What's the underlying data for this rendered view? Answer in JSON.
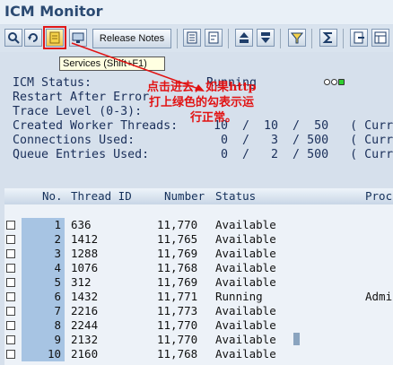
{
  "window": {
    "title": "ICM Monitor"
  },
  "toolbar": {
    "release_notes_label": "Release Notes",
    "buttons": [
      "refresh-icon",
      "reload-icon",
      "services-icon",
      "monitor-icon",
      "info-icon",
      "document-icon",
      "print-icon",
      "save-icon",
      "filter-icon",
      "sum-icon",
      "export-icon",
      "layout-icon"
    ]
  },
  "tooltip": {
    "text": "Services   (Shift+F1)"
  },
  "status": {
    "icm_status_label": "ICM Status:",
    "icm_status_value": "Running",
    "restart_label": "Restart After Error",
    "trace_level_label": "Trace Level (0-3):",
    "created_workers_label": "Created Worker Threads:",
    "created_workers_values": "10  /  10  /  50   ( Curr",
    "connections_label": "Connections Used:",
    "connections_values": "0  /   3  / 500   ( Curr",
    "queue_label": "Queue Entries Used:",
    "queue_values": "0  /   2  / 500   ( Curr"
  },
  "annotation": {
    "line1": "点击进去，如果http",
    "line2": "打上绿色的勾表示运",
    "line3": "行正常。",
    "color": "#e21212"
  },
  "table": {
    "headers": {
      "no": "No.",
      "thread_id": "Thread ID",
      "number": "Number",
      "status": "Status",
      "proc": "Proc"
    },
    "rows": [
      {
        "no": "1",
        "thread_id": "636",
        "number": "11,770",
        "status": "Available",
        "proc": ""
      },
      {
        "no": "2",
        "thread_id": "1412",
        "number": "11,765",
        "status": "Available",
        "proc": ""
      },
      {
        "no": "3",
        "thread_id": "1288",
        "number": "11,769",
        "status": "Available",
        "proc": ""
      },
      {
        "no": "4",
        "thread_id": "1076",
        "number": "11,768",
        "status": "Available",
        "proc": ""
      },
      {
        "no": "5",
        "thread_id": "312",
        "number": "11,769",
        "status": "Available",
        "proc": ""
      },
      {
        "no": "6",
        "thread_id": "1432",
        "number": "11,771",
        "status": "Running",
        "proc": "Admi"
      },
      {
        "no": "7",
        "thread_id": "2216",
        "number": "11,773",
        "status": "Available",
        "proc": ""
      },
      {
        "no": "8",
        "thread_id": "2244",
        "number": "11,770",
        "status": "Available",
        "proc": ""
      },
      {
        "no": "9",
        "thread_id": "2132",
        "number": "11,770",
        "status": "Available",
        "proc": ""
      },
      {
        "no": "10",
        "thread_id": "2160",
        "number": "11,768",
        "status": "Available",
        "proc": ""
      }
    ]
  }
}
